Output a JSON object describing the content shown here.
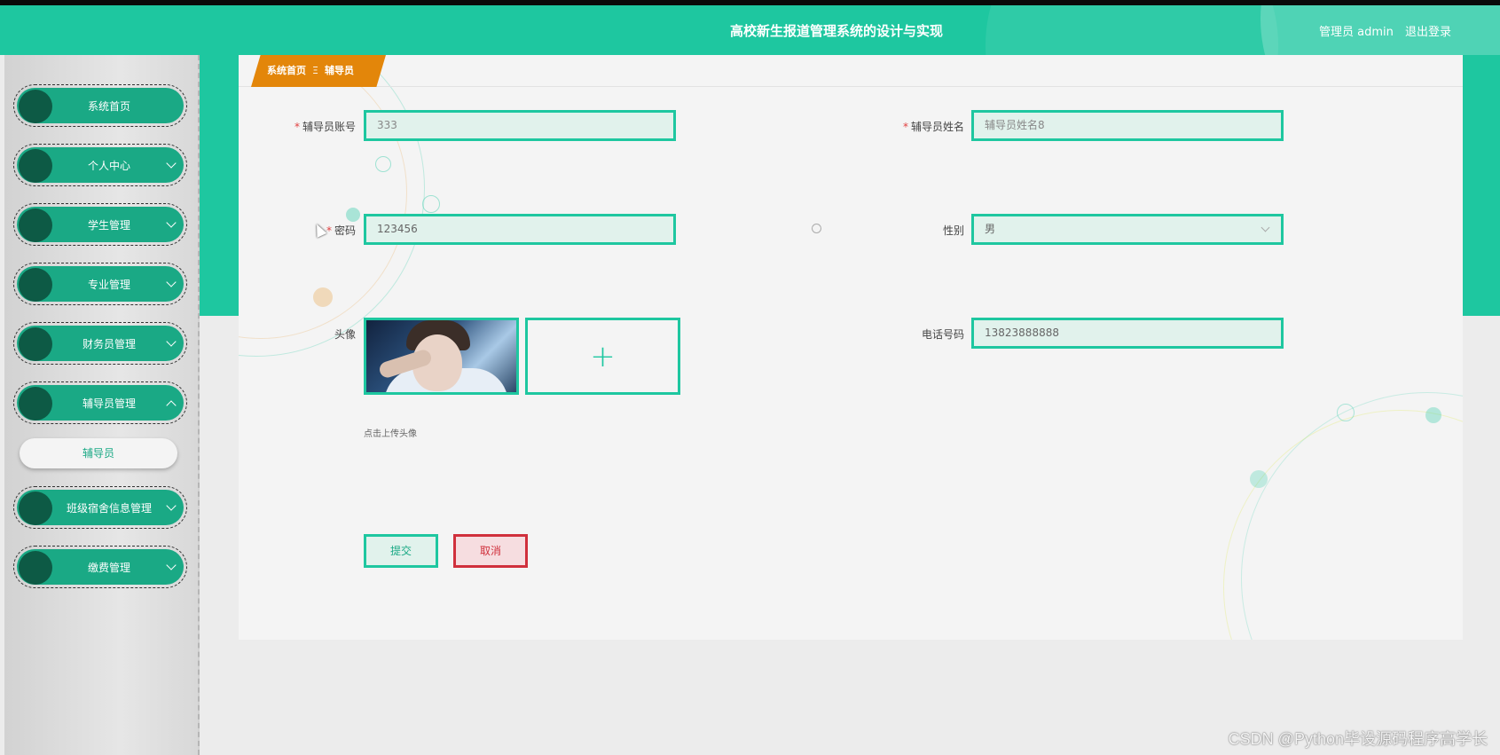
{
  "header": {
    "title": "高校新生报道管理系统的设计与实现",
    "user_label": "管理员 admin",
    "logout": "退出登录"
  },
  "sidebar": {
    "items": [
      {
        "label": "系统首页",
        "icon": "circle-icon",
        "has_arrow": false
      },
      {
        "label": "个人中心",
        "icon": "circle-icon",
        "has_arrow": true
      },
      {
        "label": "学生管理",
        "icon": "circle-icon",
        "has_arrow": true
      },
      {
        "label": "专业管理",
        "icon": "circle-icon",
        "has_arrow": true
      },
      {
        "label": "财务员管理",
        "icon": "circle-icon",
        "has_arrow": true
      },
      {
        "label": "辅导员管理",
        "icon": "circle-icon",
        "has_arrow": true,
        "expanded": true
      },
      {
        "label": "班级宿舍信息管理",
        "icon": "circle-icon",
        "has_arrow": true
      },
      {
        "label": "缴费管理",
        "icon": "circle-icon",
        "has_arrow": true
      }
    ],
    "submenu": {
      "label": "辅导员"
    }
  },
  "breadcrumb": {
    "home": "系统首页",
    "separator": "Ξ",
    "current": "辅导员"
  },
  "form": {
    "account": {
      "label": "辅导员账号",
      "value": "333",
      "required": true
    },
    "name": {
      "label": "辅导员姓名",
      "value": "辅导员姓名8",
      "required": true
    },
    "password": {
      "label": "密码",
      "value": "123456",
      "required": true
    },
    "gender": {
      "label": "性别",
      "value": "男"
    },
    "avatar": {
      "label": "头像",
      "hint": "点击上传头像"
    },
    "phone": {
      "label": "电话号码",
      "value": "13823888888"
    }
  },
  "buttons": {
    "submit": "提交",
    "cancel": "取消"
  },
  "watermark": "CSDN @Python毕设源码程序高学长",
  "colors": {
    "primary": "#1ec7a0",
    "menu_green": "#1aa985",
    "menu_dot": "#0d5a45",
    "breadcrumb": "#e3860a",
    "danger": "#d0303c"
  }
}
